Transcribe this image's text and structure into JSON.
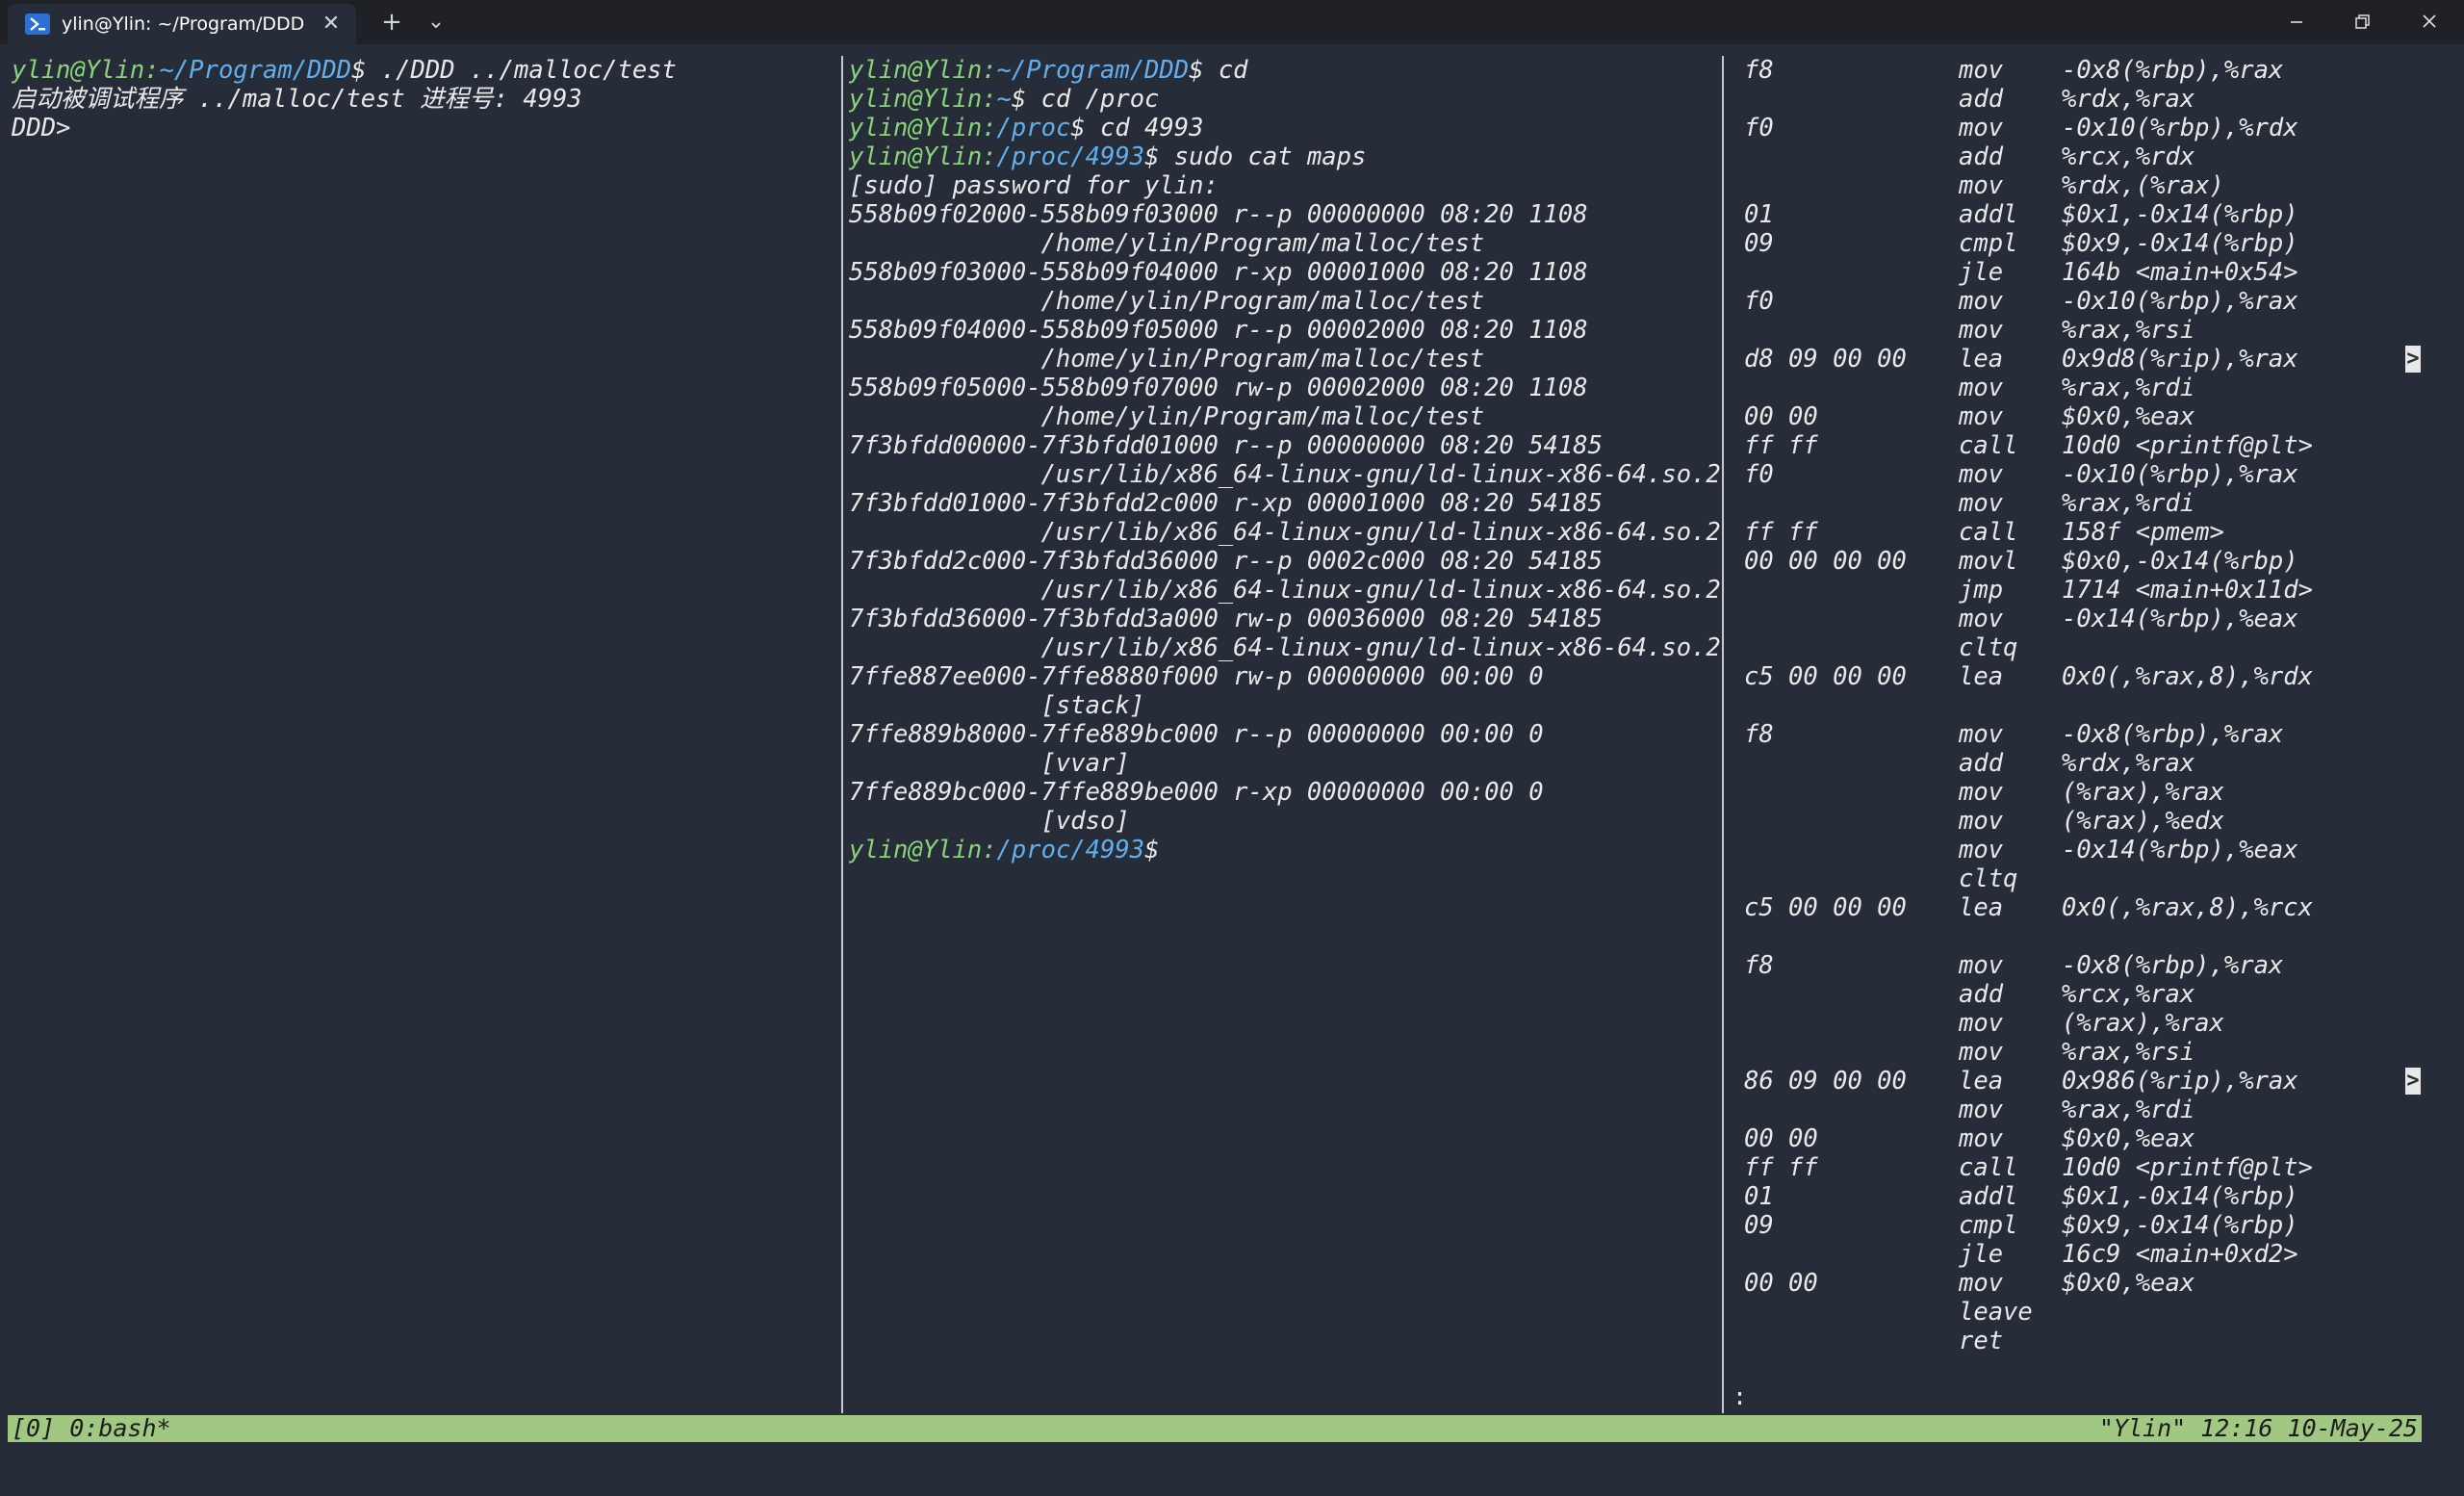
{
  "window": {
    "tab_title": "ylin@Ylin: ~/Program/DDD",
    "new_tab": "+",
    "dropdown": "⌄",
    "close_tab": "✕"
  },
  "pane1": [
    {
      "user": "ylin@Ylin",
      "path": "~/Program/DDD",
      "cmd": "$ ./DDD ../malloc/test"
    },
    {
      "text": "启动被调试程序 ../malloc/test 进程号: 4993"
    },
    {
      "text": "DDD>"
    }
  ],
  "pane2": [
    {
      "user": "ylin@Ylin",
      "path": "~/Program/DDD",
      "cmd": "$ cd"
    },
    {
      "user": "ylin@Ylin",
      "path": "~",
      "cmd": "$ cd /proc"
    },
    {
      "user": "ylin@Ylin",
      "path": "/proc",
      "cmd": "$ cd 4993"
    },
    {
      "user": "ylin@Ylin",
      "path": "/proc/4993",
      "cmd": "$ sudo cat maps"
    },
    {
      "text": "[sudo] password for ylin:"
    },
    {
      "text": "558b09f02000-558b09f03000 r--p 00000000 08:20 1108"
    },
    {
      "text": "             /home/ylin/Program/malloc/test"
    },
    {
      "text": "558b09f03000-558b09f04000 r-xp 00001000 08:20 1108"
    },
    {
      "text": "             /home/ylin/Program/malloc/test"
    },
    {
      "text": "558b09f04000-558b09f05000 r--p 00002000 08:20 1108"
    },
    {
      "text": "             /home/ylin/Program/malloc/test"
    },
    {
      "text": "558b09f05000-558b09f07000 rw-p 00002000 08:20 1108"
    },
    {
      "text": "             /home/ylin/Program/malloc/test"
    },
    {
      "text": "7f3bfdd00000-7f3bfdd01000 r--p 00000000 08:20 54185"
    },
    {
      "text": "             /usr/lib/x86_64-linux-gnu/ld-linux-x86-64.so.2"
    },
    {
      "text": "7f3bfdd01000-7f3bfdd2c000 r-xp 00001000 08:20 54185"
    },
    {
      "text": "             /usr/lib/x86_64-linux-gnu/ld-linux-x86-64.so.2"
    },
    {
      "text": "7f3bfdd2c000-7f3bfdd36000 r--p 0002c000 08:20 54185"
    },
    {
      "text": "             /usr/lib/x86_64-linux-gnu/ld-linux-x86-64.so.2"
    },
    {
      "text": "7f3bfdd36000-7f3bfdd3a000 rw-p 00036000 08:20 54185"
    },
    {
      "text": "             /usr/lib/x86_64-linux-gnu/ld-linux-x86-64.so.2"
    },
    {
      "text": "7ffe887ee000-7ffe8880f000 rw-p 00000000 00:00 0"
    },
    {
      "text": "             [stack]"
    },
    {
      "text": "7ffe889b8000-7ffe889bc000 r--p 00000000 00:00 0"
    },
    {
      "text": "             [vvar]"
    },
    {
      "text": "7ffe889bc000-7ffe889be000 r-xp 00000000 00:00 0"
    },
    {
      "text": "             [vdso]"
    },
    {
      "user": "ylin@Ylin",
      "path": "/proc/4993",
      "cmd": "$"
    }
  ],
  "pane3": [
    {
      "b": "f8",
      "op": "mov",
      "arg": "-0x8(%rbp),%rax"
    },
    {
      "b": "",
      "op": "add",
      "arg": "%rdx,%rax"
    },
    {
      "b": "f0",
      "op": "mov",
      "arg": "-0x10(%rbp),%rdx"
    },
    {
      "b": "",
      "op": "add",
      "arg": "%rcx,%rdx"
    },
    {
      "b": "",
      "op": "mov",
      "arg": "%rdx,(%rax)"
    },
    {
      "b": "01",
      "op": "addl",
      "arg": "$0x1,-0x14(%rbp)"
    },
    {
      "b": "09",
      "op": "cmpl",
      "arg": "$0x9,-0x14(%rbp)"
    },
    {
      "b": "",
      "op": "jle",
      "arg": "164b <main+0x54>"
    },
    {
      "b": "f0",
      "op": "mov",
      "arg": "-0x10(%rbp),%rax"
    },
    {
      "b": "",
      "op": "mov",
      "arg": "%rax,%rsi"
    },
    {
      "b": "d8 09 00 00",
      "op": "lea",
      "arg": "0x9d8(%rip),%rax",
      "more": true
    },
    {
      "b": "",
      "op": "mov",
      "arg": "%rax,%rdi"
    },
    {
      "b": "00 00",
      "op": "mov",
      "arg": "$0x0,%eax"
    },
    {
      "b": "ff ff",
      "op": "call",
      "arg": "10d0 <printf@plt>"
    },
    {
      "b": "f0",
      "op": "mov",
      "arg": "-0x10(%rbp),%rax"
    },
    {
      "b": "",
      "op": "mov",
      "arg": "%rax,%rdi"
    },
    {
      "b": "ff ff",
      "op": "call",
      "arg": "158f <pmem>"
    },
    {
      "b": "00 00 00 00",
      "op": "movl",
      "arg": "$0x0,-0x14(%rbp)"
    },
    {
      "b": "",
      "op": "jmp",
      "arg": "1714 <main+0x11d>"
    },
    {
      "b": "",
      "op": "mov",
      "arg": "-0x14(%rbp),%eax"
    },
    {
      "b": "",
      "op": "cltq",
      "arg": ""
    },
    {
      "b": "c5 00 00 00",
      "op": "lea",
      "arg": "0x0(,%rax,8),%rdx"
    },
    {
      "b": "",
      "op": "",
      "arg": ""
    },
    {
      "b": "f8",
      "op": "mov",
      "arg": "-0x8(%rbp),%rax"
    },
    {
      "b": "",
      "op": "add",
      "arg": "%rdx,%rax"
    },
    {
      "b": "",
      "op": "mov",
      "arg": "(%rax),%rax"
    },
    {
      "b": "",
      "op": "mov",
      "arg": "(%rax),%edx"
    },
    {
      "b": "",
      "op": "mov",
      "arg": "-0x14(%rbp),%eax"
    },
    {
      "b": "",
      "op": "cltq",
      "arg": ""
    },
    {
      "b": "c5 00 00 00",
      "op": "lea",
      "arg": "0x0(,%rax,8),%rcx"
    },
    {
      "b": "",
      "op": "",
      "arg": ""
    },
    {
      "b": "f8",
      "op": "mov",
      "arg": "-0x8(%rbp),%rax"
    },
    {
      "b": "",
      "op": "add",
      "arg": "%rcx,%rax"
    },
    {
      "b": "",
      "op": "mov",
      "arg": "(%rax),%rax"
    },
    {
      "b": "",
      "op": "mov",
      "arg": "%rax,%rsi"
    },
    {
      "b": "86 09 00 00",
      "op": "lea",
      "arg": "0x986(%rip),%rax",
      "more": true
    },
    {
      "b": "",
      "op": "mov",
      "arg": "%rax,%rdi"
    },
    {
      "b": "00 00",
      "op": "mov",
      "arg": "$0x0,%eax"
    },
    {
      "b": "ff ff",
      "op": "call",
      "arg": "10d0 <printf@plt>"
    },
    {
      "b": "01",
      "op": "addl",
      "arg": "$0x1,-0x14(%rbp)"
    },
    {
      "b": "09",
      "op": "cmpl",
      "arg": "$0x9,-0x14(%rbp)"
    },
    {
      "b": "",
      "op": "jle",
      "arg": "16c9 <main+0xd2>"
    },
    {
      "b": "00 00",
      "op": "mov",
      "arg": "$0x0,%eax"
    },
    {
      "b": "",
      "op": "leave",
      "arg": ""
    },
    {
      "b": "",
      "op": "ret",
      "arg": ""
    }
  ],
  "pane3_more_marker": ">",
  "pane3_prompt": ":",
  "status": {
    "left": "[0] 0:bash*",
    "right": "\"Ylin\" 12:16 10-May-25"
  },
  "colors": {
    "prompt_user": "#89d37a",
    "prompt_path": "#61afef",
    "status_bg": "#a0c883",
    "bg": "#272d38"
  }
}
